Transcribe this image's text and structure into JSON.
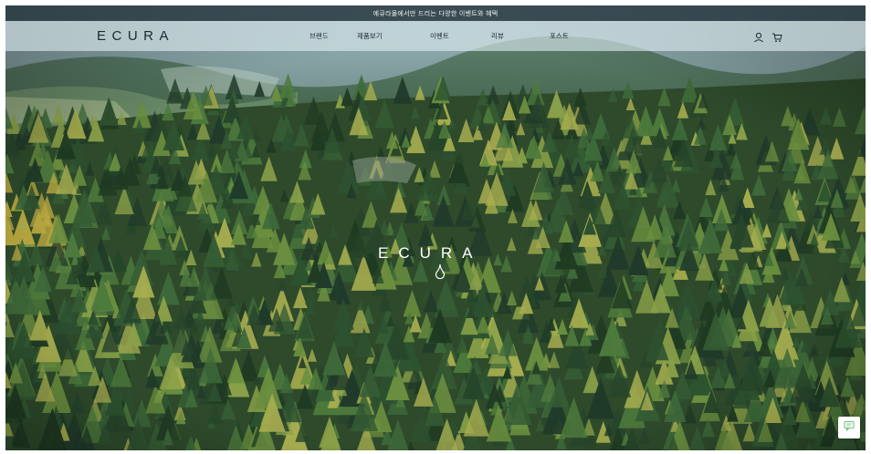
{
  "announcement": {
    "text": "에큐라몰에서만 드리는 다양한 이벤트와 혜택"
  },
  "header": {
    "logo": "ECURA",
    "menu": [
      {
        "label": "브랜드"
      },
      {
        "label": "제품보기"
      },
      {
        "label": "이벤트"
      },
      {
        "label": "리뷰"
      },
      {
        "label": "포스트"
      }
    ],
    "icons": [
      "user-icon",
      "cart-icon"
    ]
  },
  "hero": {
    "logo": "ECURA",
    "background": "aerial view of forested mountain slope"
  },
  "chat": {
    "icon": "chat-icon"
  },
  "colors": {
    "announce_bg": "#22323a",
    "nav_bg": "#deeef2",
    "text_dark": "#1c2830",
    "hero_text": "#ffffff",
    "forest_dark": "#2f4a2c",
    "chat_accent": "#6cbf7a"
  }
}
